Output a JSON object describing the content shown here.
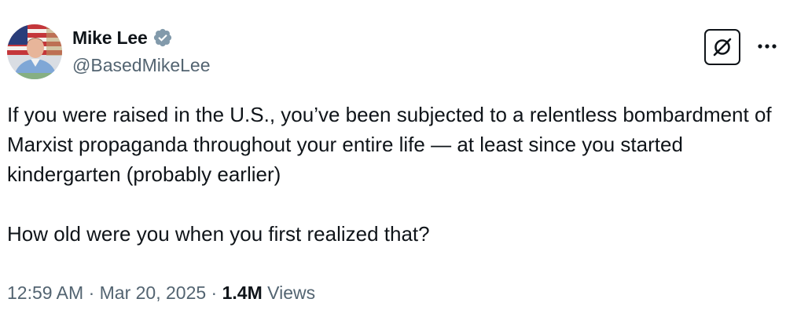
{
  "author": {
    "display_name": "Mike Lee",
    "handle": "@BasedMikeLee",
    "verified": true,
    "verified_color": "#829aab"
  },
  "actions": {
    "grok_icon": "grok-icon",
    "more_icon": "more-icon"
  },
  "tweet": {
    "paragraph_1": "If you were raised in the U.S., you’ve been subjected to a relentless bombardment of Marxist propaganda throughout your entire life — at least since you started kindergarten (probably earlier)",
    "paragraph_2": "How old were you when you first realized that?"
  },
  "meta": {
    "time": "12:59 AM",
    "separator": " · ",
    "date": "Mar 20, 2025",
    "views_count": "1.4M",
    "views_label": "Views"
  },
  "colors": {
    "text_primary": "#0f1419",
    "text_secondary": "#536471"
  }
}
